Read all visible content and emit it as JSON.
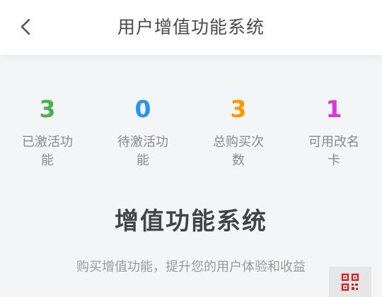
{
  "header": {
    "title": "用户增值功能系统",
    "back_icon": "chevron-left-icon"
  },
  "stats": [
    {
      "value": "3",
      "label": "已激活功能",
      "color": "#4caf50"
    },
    {
      "value": "0",
      "label": "待激活功能",
      "color": "#2196f3"
    },
    {
      "value": "3",
      "label": "总购买次数",
      "color": "#ff9800"
    },
    {
      "value": "1",
      "label": "可用改名卡",
      "color": "#d63adf"
    }
  ],
  "hero": {
    "title": "增值功能系统",
    "subtitle": "购买增值功能，提升您的用户体验和收益"
  },
  "floating": {
    "qr_icon": "qr-code-icon",
    "qr_color": "#c62828"
  }
}
